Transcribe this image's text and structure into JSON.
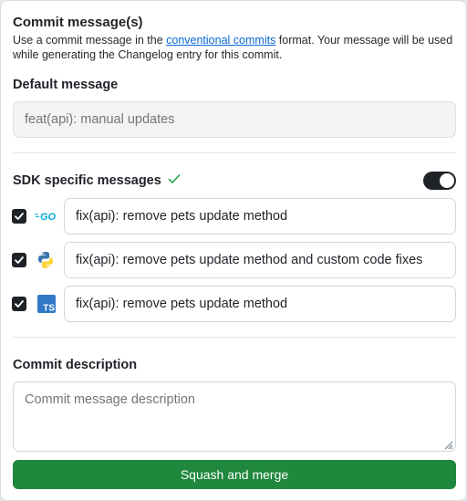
{
  "commit_messages": {
    "title": "Commit message(s)",
    "intro_before": "Use a commit message in the ",
    "intro_link": "conventional commits",
    "intro_after": " format. Your message will be used while generating the Changelog entry for this commit."
  },
  "default_message": {
    "label": "Default message",
    "placeholder": "feat(api): manual updates"
  },
  "sdk_messages": {
    "label": "SDK specific messages",
    "toggle_on": true,
    "rows": [
      {
        "icon": "go-icon",
        "checked": true,
        "value": "fix(api): remove pets update method"
      },
      {
        "icon": "python-icon",
        "checked": true,
        "value": "fix(api): remove pets update method and custom code fixes"
      },
      {
        "icon": "typescript-icon",
        "checked": true,
        "value": "fix(api): remove pets update method"
      }
    ]
  },
  "commit_description": {
    "label": "Commit description",
    "placeholder": "Commit message description"
  },
  "actions": {
    "squash_merge": "Squash and merge"
  },
  "colors": {
    "accent_green": "#1f883d",
    "link_blue": "#0969da"
  }
}
